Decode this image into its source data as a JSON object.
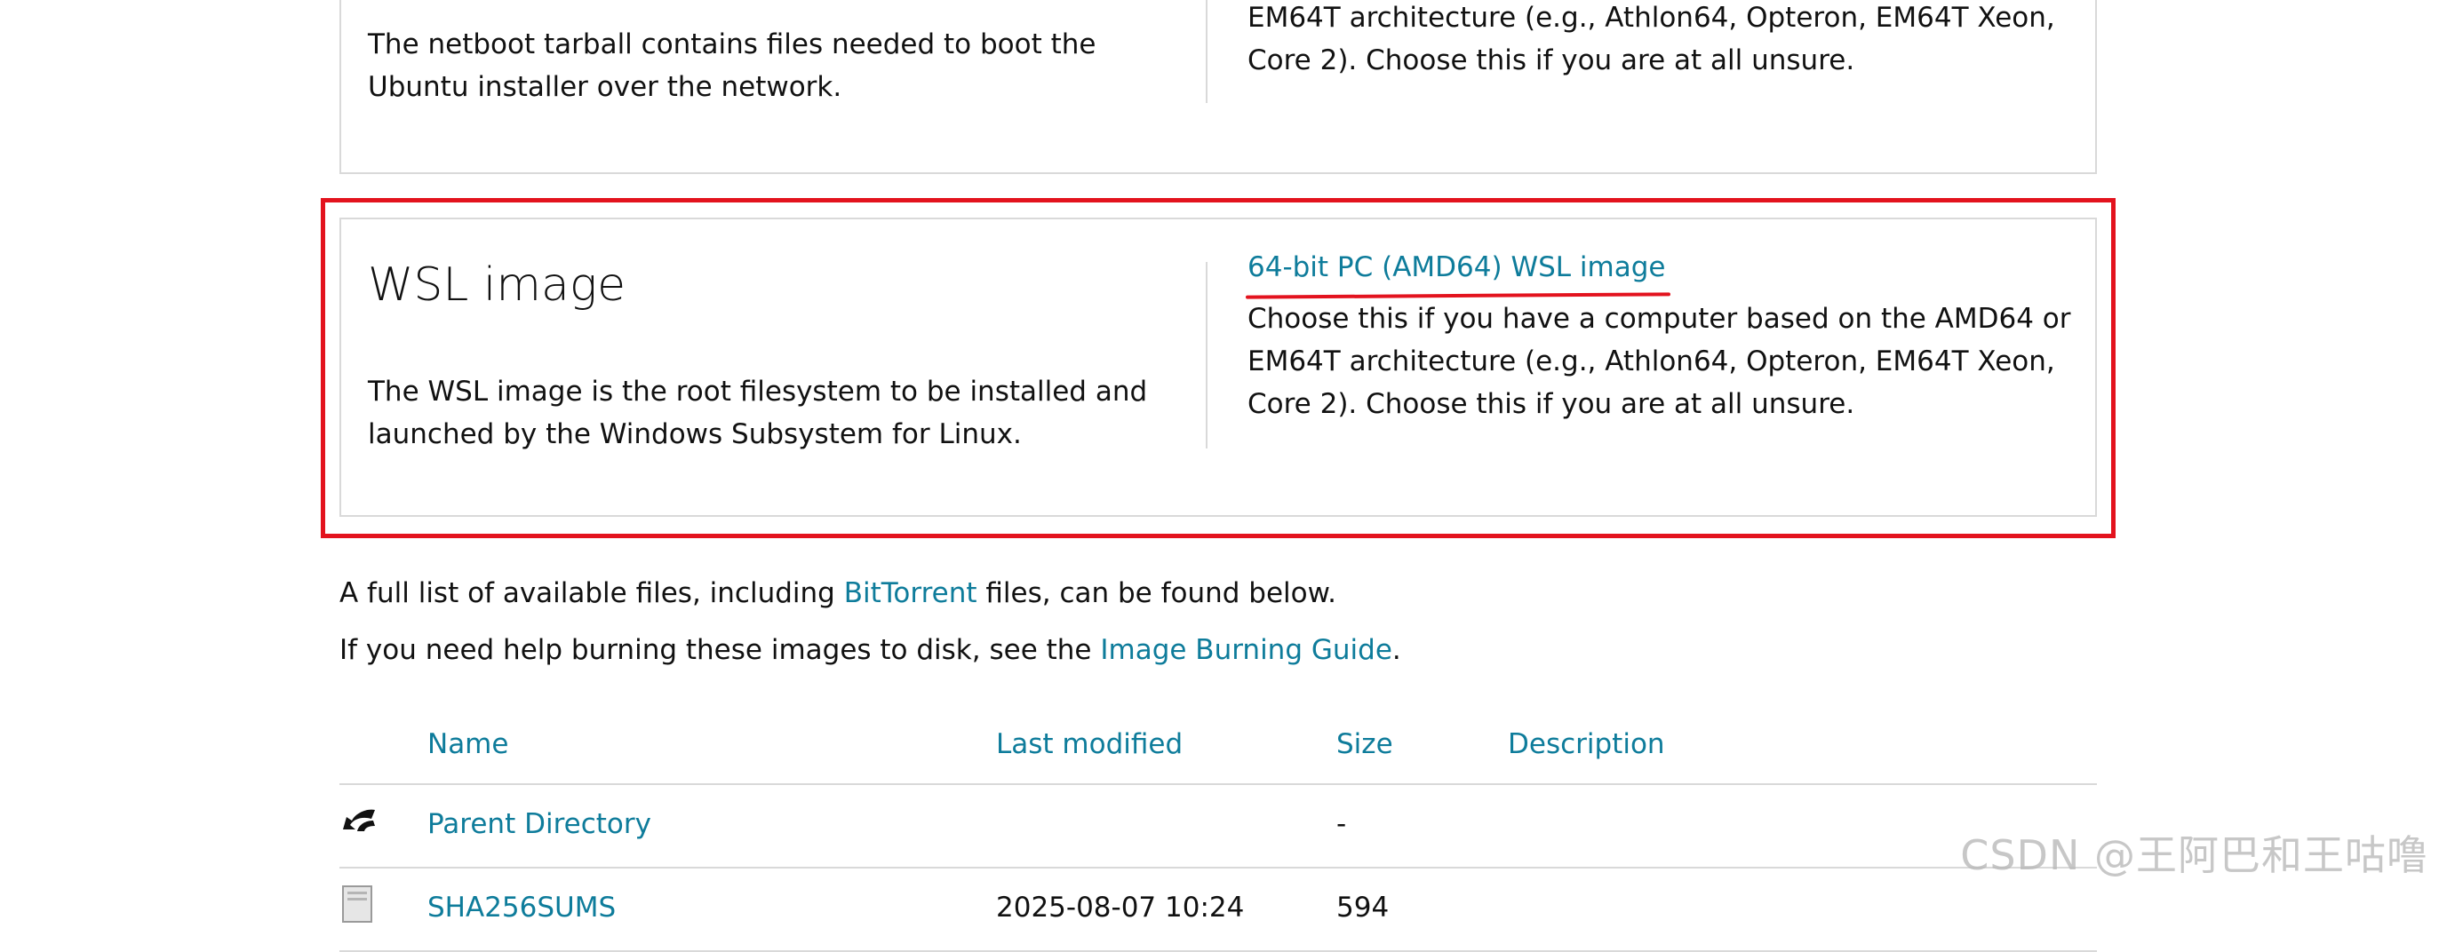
{
  "netboot_card": {
    "description": "The netboot tarball contains files needed to boot the Ubuntu installer over the network.",
    "arch_desc": "EM64T architecture (e.g., Athlon64, Opteron, EM64T Xeon, Core 2). Choose this if you are at all unsure."
  },
  "wsl_card": {
    "title": "WSL image",
    "description": "The WSL image is the root filesystem to be installed and launched by the Windows Subsystem for Linux.",
    "link": "64-bit PC (AMD64) WSL image",
    "link_desc": "Choose this if you have a computer based on the AMD64 or EM64T architecture (e.g., Athlon64, Opteron, EM64T Xeon, Core 2). Choose this if you are at all unsure."
  },
  "info": {
    "line1_pre": "A full list of available files, including ",
    "line1_link": "BitTorrent",
    "line1_post": " files, can be found below.",
    "line2_pre": "If you need help burning these images to disk, see the ",
    "line2_link": "Image Burning Guide",
    "line2_post": "."
  },
  "table": {
    "headers": {
      "name": "Name",
      "last_modified": "Last modified",
      "size": "Size",
      "description": "Description"
    },
    "rows": [
      {
        "name": "Parent Directory",
        "last_modified": "",
        "size": "-",
        "description": "",
        "icon": "back-arrow-icon"
      },
      {
        "name": "SHA256SUMS",
        "last_modified": "2025-08-07 10:24",
        "size": "594",
        "description": "",
        "icon": "file-icon"
      }
    ]
  },
  "watermark": "CSDN @王阿巴和王咕噜",
  "colors": {
    "link": "#0e7c9b",
    "highlight": "#e3131e",
    "border": "#d9d9d9"
  }
}
